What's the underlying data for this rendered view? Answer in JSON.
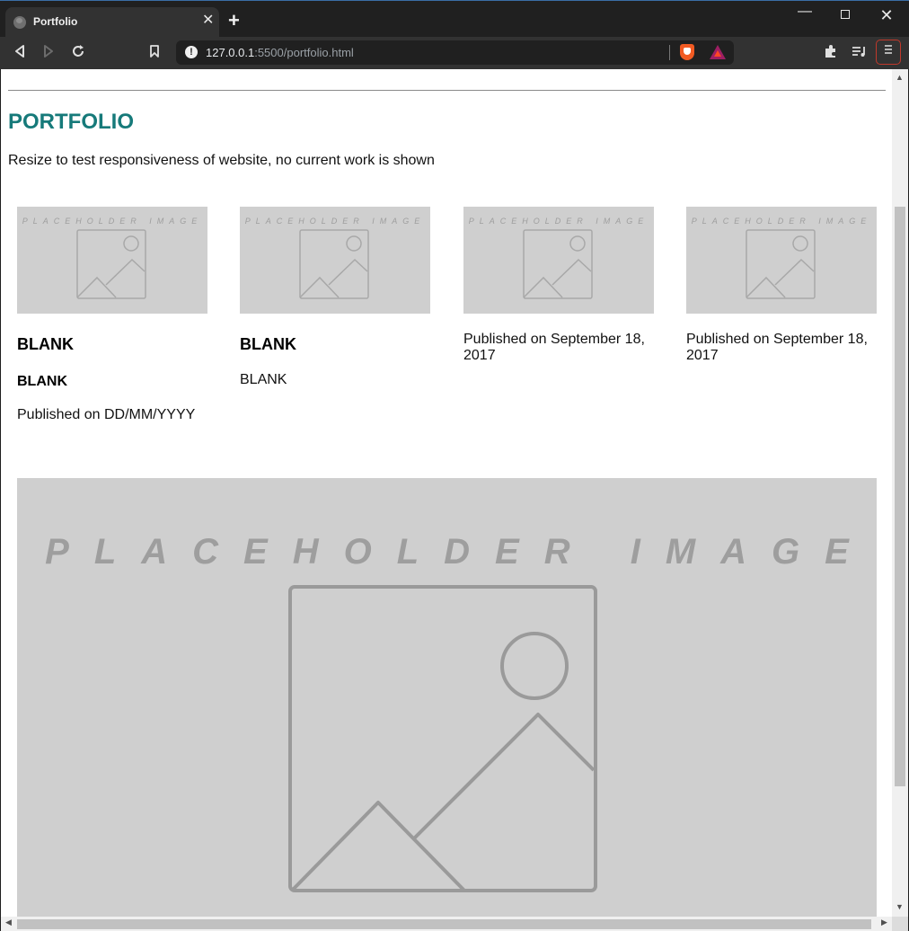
{
  "browser": {
    "tab_title": "Portfolio",
    "tab_close": "✕",
    "new_tab": "+",
    "url_host": "127.0.0.1",
    "url_rest": ":5500/portfolio.html",
    "icons": [
      "back-icon",
      "forward-icon",
      "reload-icon",
      "bookmark-icon",
      "site-info-icon",
      "brave-shields-icon",
      "brave-rewards-icon",
      "extensions-icon",
      "playlist-icon",
      "menu-icon"
    ]
  },
  "window_controls": {
    "minimize": "—",
    "close": "✕"
  },
  "page": {
    "title": "PORTFOLIO",
    "subtitle": "Resize to test responsiveness of website, no current work is shown",
    "accent_color": "#167a7a",
    "placeholder_label": "PLACEHOLDER IMAGE",
    "cards": [
      {
        "heading": "BLANK",
        "subheading": "BLANK",
        "published": "Published on DD/MM/YYYY"
      },
      {
        "heading": "BLANK",
        "body": "BLANK"
      },
      {
        "published": "Published on September 18, 2017"
      },
      {
        "published": "Published on September 18, 2017"
      }
    ],
    "featured_placeholder_label": "PLACEHOLDER IMAGE"
  }
}
